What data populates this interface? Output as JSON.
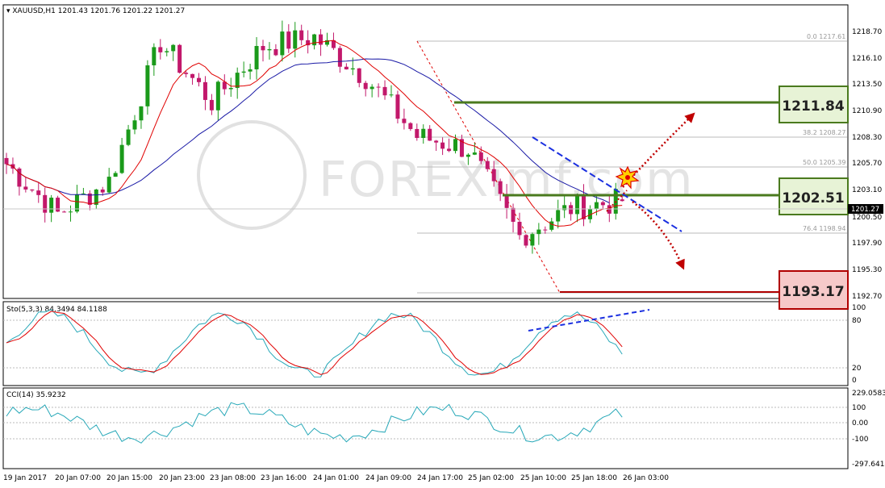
{
  "header": {
    "symbol": "XAUUSD,H1",
    "ohlc": "1201.43 1201.76 1201.22 1201.27"
  },
  "watermark": "FOREXimf.com",
  "price_axis": {
    "labels": [
      "1218.70",
      "1216.10",
      "1213.50",
      "1210.90",
      "1208.30",
      "1205.70",
      "1203.10",
      "1200.50",
      "1197.90",
      "1195.30",
      "1192.70"
    ],
    "current_price": "1201.27"
  },
  "time_axis": {
    "labels": [
      "19 Jan 2017",
      "20 Jan 07:00",
      "20 Jan 15:00",
      "20 Jan 23:00",
      "23 Jan 08:00",
      "23 Jan 16:00",
      "24 Jan 01:00",
      "24 Jan 09:00",
      "24 Jan 17:00",
      "25 Jan 02:00",
      "25 Jan 10:00",
      "25 Jan 18:00",
      "26 Jan 03:00"
    ]
  },
  "fibonacci": {
    "levels": [
      {
        "label": "0.0",
        "price": "1217.61"
      },
      {
        "label": "38.2",
        "price": "1208.27"
      },
      {
        "label": "50.0",
        "price": "1205.39"
      },
      {
        "label": "76.4",
        "price": "1198.94"
      }
    ]
  },
  "levels": [
    {
      "label": "1211.84",
      "kind": "resistance",
      "color": "#4a7a1e",
      "fill": "#e7f3d6"
    },
    {
      "label": "1202.51",
      "kind": "pivot",
      "color": "#4a7a1e",
      "fill": "#e7f3d6"
    },
    {
      "label": "1193.17",
      "kind": "support",
      "color": "#b00000",
      "fill": "#f6c9c9"
    }
  ],
  "colors": {
    "bull_candle": "#1a9a1a",
    "bear_candle": "#c2186b",
    "ma_fast": "#e00000",
    "ma_slow": "#1a1aa6",
    "trendline": "#1a2fe0",
    "arrow": "#c00000",
    "stoch_main": "#27a8b8",
    "stoch_signal": "#e00000",
    "cci": "#27a8b8"
  },
  "stochastic": {
    "title": "Sto(5,3,3) 84.3494 84.1188",
    "axis_labels": [
      "100",
      "80",
      "20",
      "0"
    ]
  },
  "cci": {
    "title": "CCI(14) 35.9232",
    "axis_labels": [
      "229.0583",
      "100",
      "0.00",
      "-100",
      "-297.6414"
    ]
  },
  "chart_data": {
    "type": "candlestick",
    "title": "XAUUSD,H1",
    "ylim": [
      1191.9,
      1220.3
    ],
    "x": [
      "19 Jan 2017",
      "20 Jan 07:00",
      "20 Jan 15:00",
      "20 Jan 23:00",
      "23 Jan 08:00",
      "23 Jan 16:00",
      "24 Jan 01:00",
      "24 Jan 09:00",
      "24 Jan 17:00",
      "25 Jan 02:00",
      "25 Jan 10:00",
      "25 Jan 18:00",
      "26 Jan 03:00"
    ],
    "close_points": [
      1204.9,
      1200.0,
      1203.2,
      1216.8,
      1211.0,
      1216.4,
      1217.3,
      1213.4,
      1207.6,
      1206.4,
      1197.8,
      1200.6,
      1201.27
    ],
    "last": {
      "open": 1201.43,
      "high": 1201.76,
      "low": 1201.22,
      "close": 1201.27
    },
    "grid": false
  }
}
